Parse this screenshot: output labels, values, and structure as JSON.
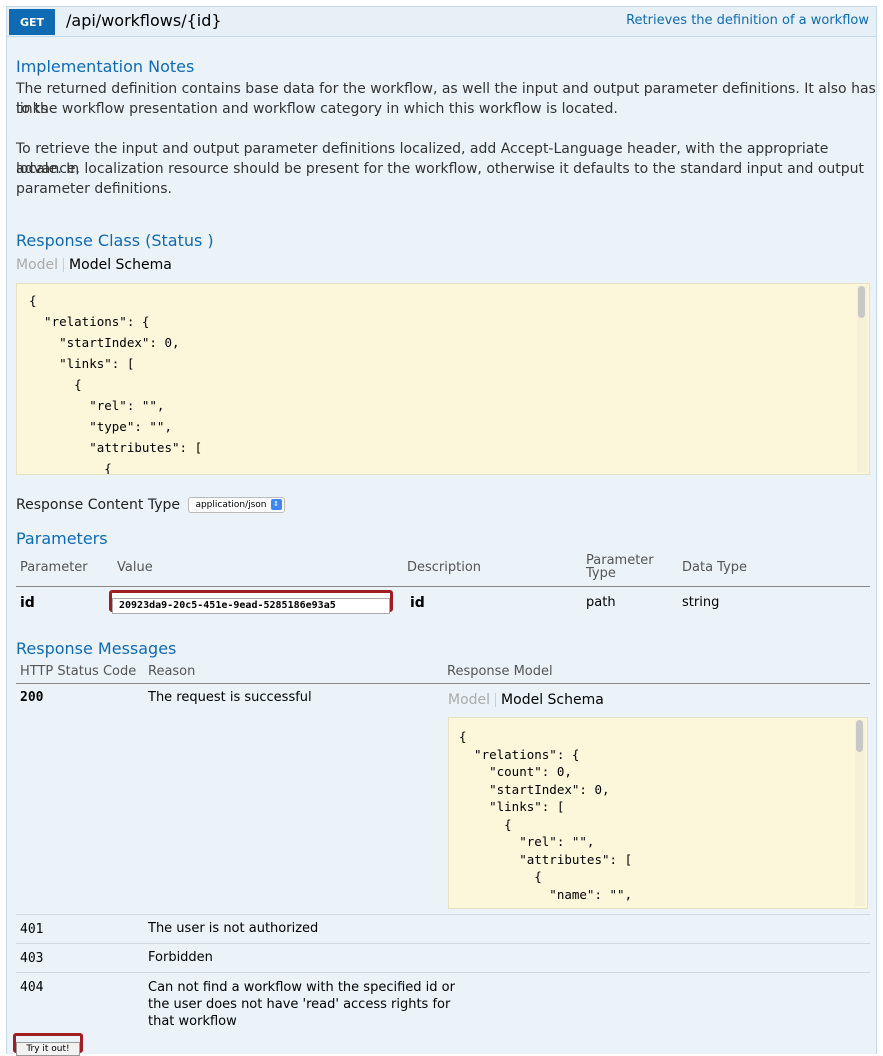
{
  "endpoint": {
    "method": "GET",
    "path": "/api/workflows/{id}",
    "summary": "Retrieves the definition of a workflow"
  },
  "implementation_notes": {
    "title": "Implementation Notes",
    "para1_line1": "The returned definition contains base data for the workflow, as well the input and output parameter definitions. It also has links",
    "para1_line2": "to the workflow presentation and workflow category in which this workflow is located.",
    "para2_line1": "To retrieve the input and output parameter definitions localized, add Accept-Language header, with the appropriate locale. In",
    "para2_line2": "advance, localization resource should be present for the workflow, otherwise it defaults to the standard input and output",
    "para2_line3": "parameter definitions."
  },
  "response_class": {
    "title": "Response Class (Status )",
    "tab_model": "Model",
    "tab_schema": "Model Schema",
    "schema_text": "{\n  \"relations\": {\n    \"startIndex\": 0,\n    \"links\": [\n      {\n        \"rel\": \"\",\n        \"type\": \"\",\n        \"attributes\": [\n          {"
  },
  "response_content_type": {
    "label": "Response Content Type",
    "value": "application/json"
  },
  "parameters": {
    "title": "Parameters",
    "headers": {
      "parameter": "Parameter",
      "value": "Value",
      "description": "Description",
      "param_type_1": "Parameter",
      "param_type_2": "Type",
      "data_type": "Data Type"
    },
    "rows": [
      {
        "name": "id",
        "value": "20923da9-20c5-451e-9ead-5285186e93a5",
        "description": "id",
        "param_type": "path",
        "data_type": "string"
      }
    ]
  },
  "response_messages": {
    "title": "Response Messages",
    "headers": {
      "code": "HTTP Status Code",
      "reason": "Reason",
      "model": "Response Model"
    },
    "row200": {
      "code": "200",
      "reason": "The request is successful",
      "tab_model": "Model",
      "tab_schema": "Model Schema",
      "schema_text": "{\n  \"relations\": {\n    \"count\": 0,\n    \"startIndex\": 0,\n    \"links\": [\n      {\n        \"rel\": \"\",\n        \"attributes\": [\n          {\n            \"name\": \"\","
    },
    "row401": {
      "code": "401",
      "reason": "The user is not authorized"
    },
    "row403": {
      "code": "403",
      "reason": "Forbidden"
    },
    "row404": {
      "code": "404",
      "reason_line1": "Can not find a workflow with the specified id or",
      "reason_line2": "the user does not have 'read' access rights for",
      "reason_line3": "that workflow"
    }
  },
  "try_button": "Try it out!",
  "colors": {
    "accent": "#0f6ab4",
    "panel": "#ebf3f9",
    "code_bg": "#fcf6db",
    "highlight_border": "#a01e22"
  }
}
